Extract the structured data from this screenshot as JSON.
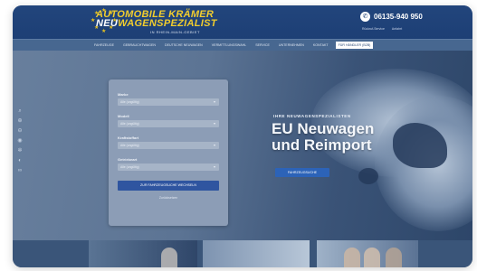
{
  "header": {
    "logo_line1": "AUTOMOBILE KRÄMER",
    "logo_line2_prefix": "NEU",
    "logo_line2_rest": "WAGENSPEZIALIST",
    "logo_subline": "IN RHEIN-MAIN-GEBIET",
    "phone": "06135-940 950",
    "links": [
      "Rückruf-Service",
      "Anfahrt"
    ]
  },
  "nav": {
    "items": [
      "FAHRZEUGE",
      "GEBRAUCHTWAGEN",
      "DEUTSCHE NEUWAGEN",
      "VERMITTLUNGSWAHL",
      "SERVICE",
      "UNTERNEHMEN",
      "KONTAKT",
      "FÜR HÄNDLER (B2B)"
    ]
  },
  "search_form": {
    "fields": [
      {
        "label": "Marke",
        "value": "Alle (ungültig)"
      },
      {
        "label": "Modell",
        "value": "Alle (ungültig)"
      },
      {
        "label": "Kraftstoffart",
        "value": "Alle (ungültig)"
      },
      {
        "label": "Getriebeart",
        "value": "Alle (ungültig)"
      }
    ],
    "submit_label": "ZUR FAHRZEUGSUCHE WECHSELN",
    "reset_label": "Zurücksetzen"
  },
  "hero": {
    "kicker": "IHRE NEUWAGENSPEZIALISTEN",
    "headline": "EU Neuwagen und Reimport",
    "cta_label": "FAHRZEUGSUCHE"
  },
  "colors": {
    "brand_blue": "#1d3f75",
    "logo_yellow": "#f1cd2e",
    "cta_blue": "#2c63b8"
  },
  "icons": [
    "star-icon",
    "phone-icon",
    "chevron-down-icon",
    "search-icon",
    "zoom-in-icon",
    "zoom-out-icon",
    "eye-icon",
    "settings-icon"
  ]
}
